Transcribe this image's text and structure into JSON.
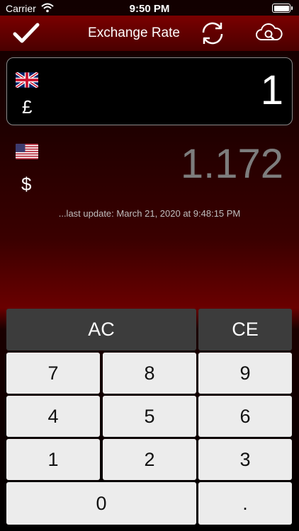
{
  "status_bar": {
    "carrier": "Carrier",
    "time": "9:50 PM"
  },
  "nav": {
    "title": "Exchange Rate",
    "done_icon": "checkmark-icon",
    "refresh_icon": "refresh-icon",
    "cloud_icon": "cloud-search-icon"
  },
  "from": {
    "flag": "uk-flag-icon",
    "symbol": "£",
    "amount": "1"
  },
  "to": {
    "flag": "us-flag-icon",
    "symbol": "$",
    "amount": "1.172"
  },
  "last_update": "...last update:  March 21, 2020 at 9:48:15 PM",
  "keypad": {
    "ac": "AC",
    "ce": "CE",
    "k7": "7",
    "k8": "8",
    "k9": "9",
    "k4": "4",
    "k5": "5",
    "k6": "6",
    "k1": "1",
    "k2": "2",
    "k3": "3",
    "k0": "0",
    "dot": "."
  },
  "colors": {
    "nav_bar": "#5a0000",
    "background_accent": "#6a0000",
    "key_light": "#ececec",
    "key_dark": "#3c3c3c",
    "converted_text": "#7d7d7d"
  }
}
